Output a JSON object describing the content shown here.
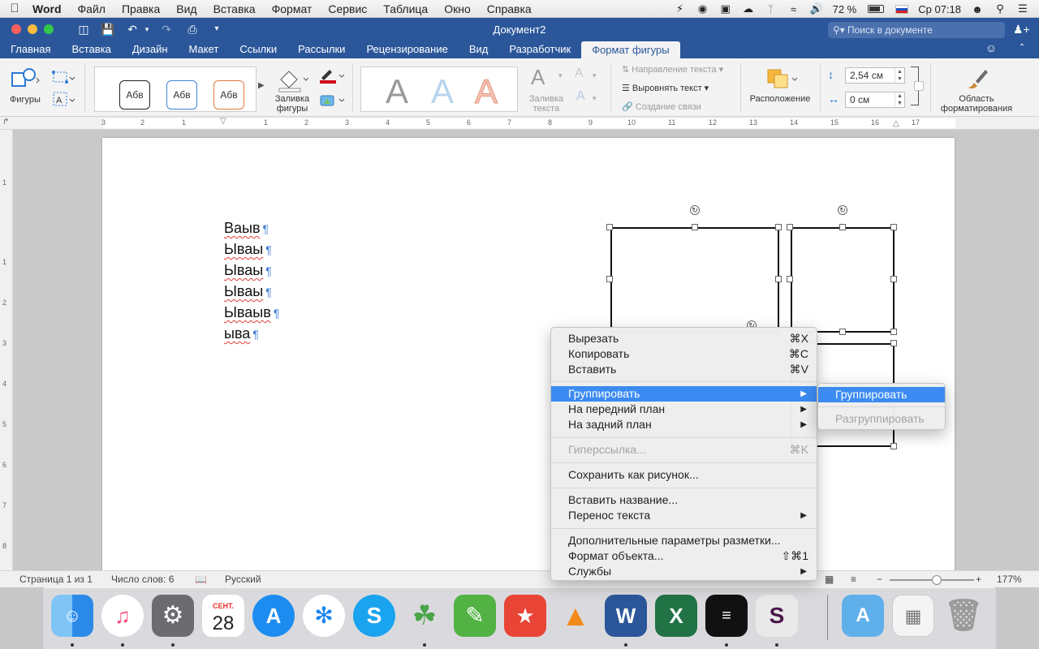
{
  "menubar": {
    "app": "Word",
    "items": [
      "Файл",
      "Правка",
      "Вид",
      "Вставка",
      "Формат",
      "Сервис",
      "Таблица",
      "Окно",
      "Справка"
    ],
    "battery": "72 %",
    "clock": "Ср 07:18"
  },
  "window": {
    "title": "Документ2",
    "search_placeholder": "Поиск в документе"
  },
  "tabs": [
    "Главная",
    "Вставка",
    "Дизайн",
    "Макет",
    "Ссылки",
    "Рассылки",
    "Рецензирование",
    "Вид",
    "Разработчик",
    "Формат фигуры"
  ],
  "ribbon": {
    "shapes_label": "Фигуры",
    "style_sample": "Абв",
    "fill_shape_label_1": "Заливка",
    "fill_shape_label_2": "фигуры",
    "text_fill_label_1": "Заливка",
    "text_fill_label_2": "текста",
    "text_direction": "Направление текста",
    "align_text": "Выровнять текст",
    "create_link": "Создание связи",
    "arrange_label": "Расположение",
    "height_value": "2,54 см",
    "width_value": "0 см",
    "format_pane_1": "Область",
    "format_pane_2": "форматирования"
  },
  "document": {
    "lines": [
      "Ваыв",
      "Ываы",
      "Ываы",
      "Ываы",
      "Ываыв",
      "ыва"
    ]
  },
  "context_menu": {
    "cut": "Вырезать",
    "cut_sc": "⌘X",
    "copy": "Копировать",
    "copy_sc": "⌘C",
    "paste": "Вставить",
    "paste_sc": "⌘V",
    "group": "Группировать",
    "bring_front": "На передний план",
    "send_back": "На задний план",
    "hyperlink": "Гиперссылка...",
    "hyperlink_sc": "⌘K",
    "save_as_picture": "Сохранить как рисунок...",
    "insert_caption": "Вставить название...",
    "wrap_text": "Перенос текста",
    "more_layout": "Дополнительные параметры разметки...",
    "format_object": "Формат объекта...",
    "format_object_sc": "⇧⌘1",
    "services": "Службы"
  },
  "submenu": {
    "group": "Группировать",
    "ungroup": "Разгруппировать"
  },
  "statusbar": {
    "page": "Страница 1 из 1",
    "words": "Число слов: 6",
    "language": "Русский",
    "zoom": "177%"
  },
  "dock": {
    "calendar_month": "СЕНТ.",
    "calendar_day": "28"
  },
  "colors": {
    "ribbon_blue": "#2b579a",
    "highlight": "#3b8bf3"
  }
}
